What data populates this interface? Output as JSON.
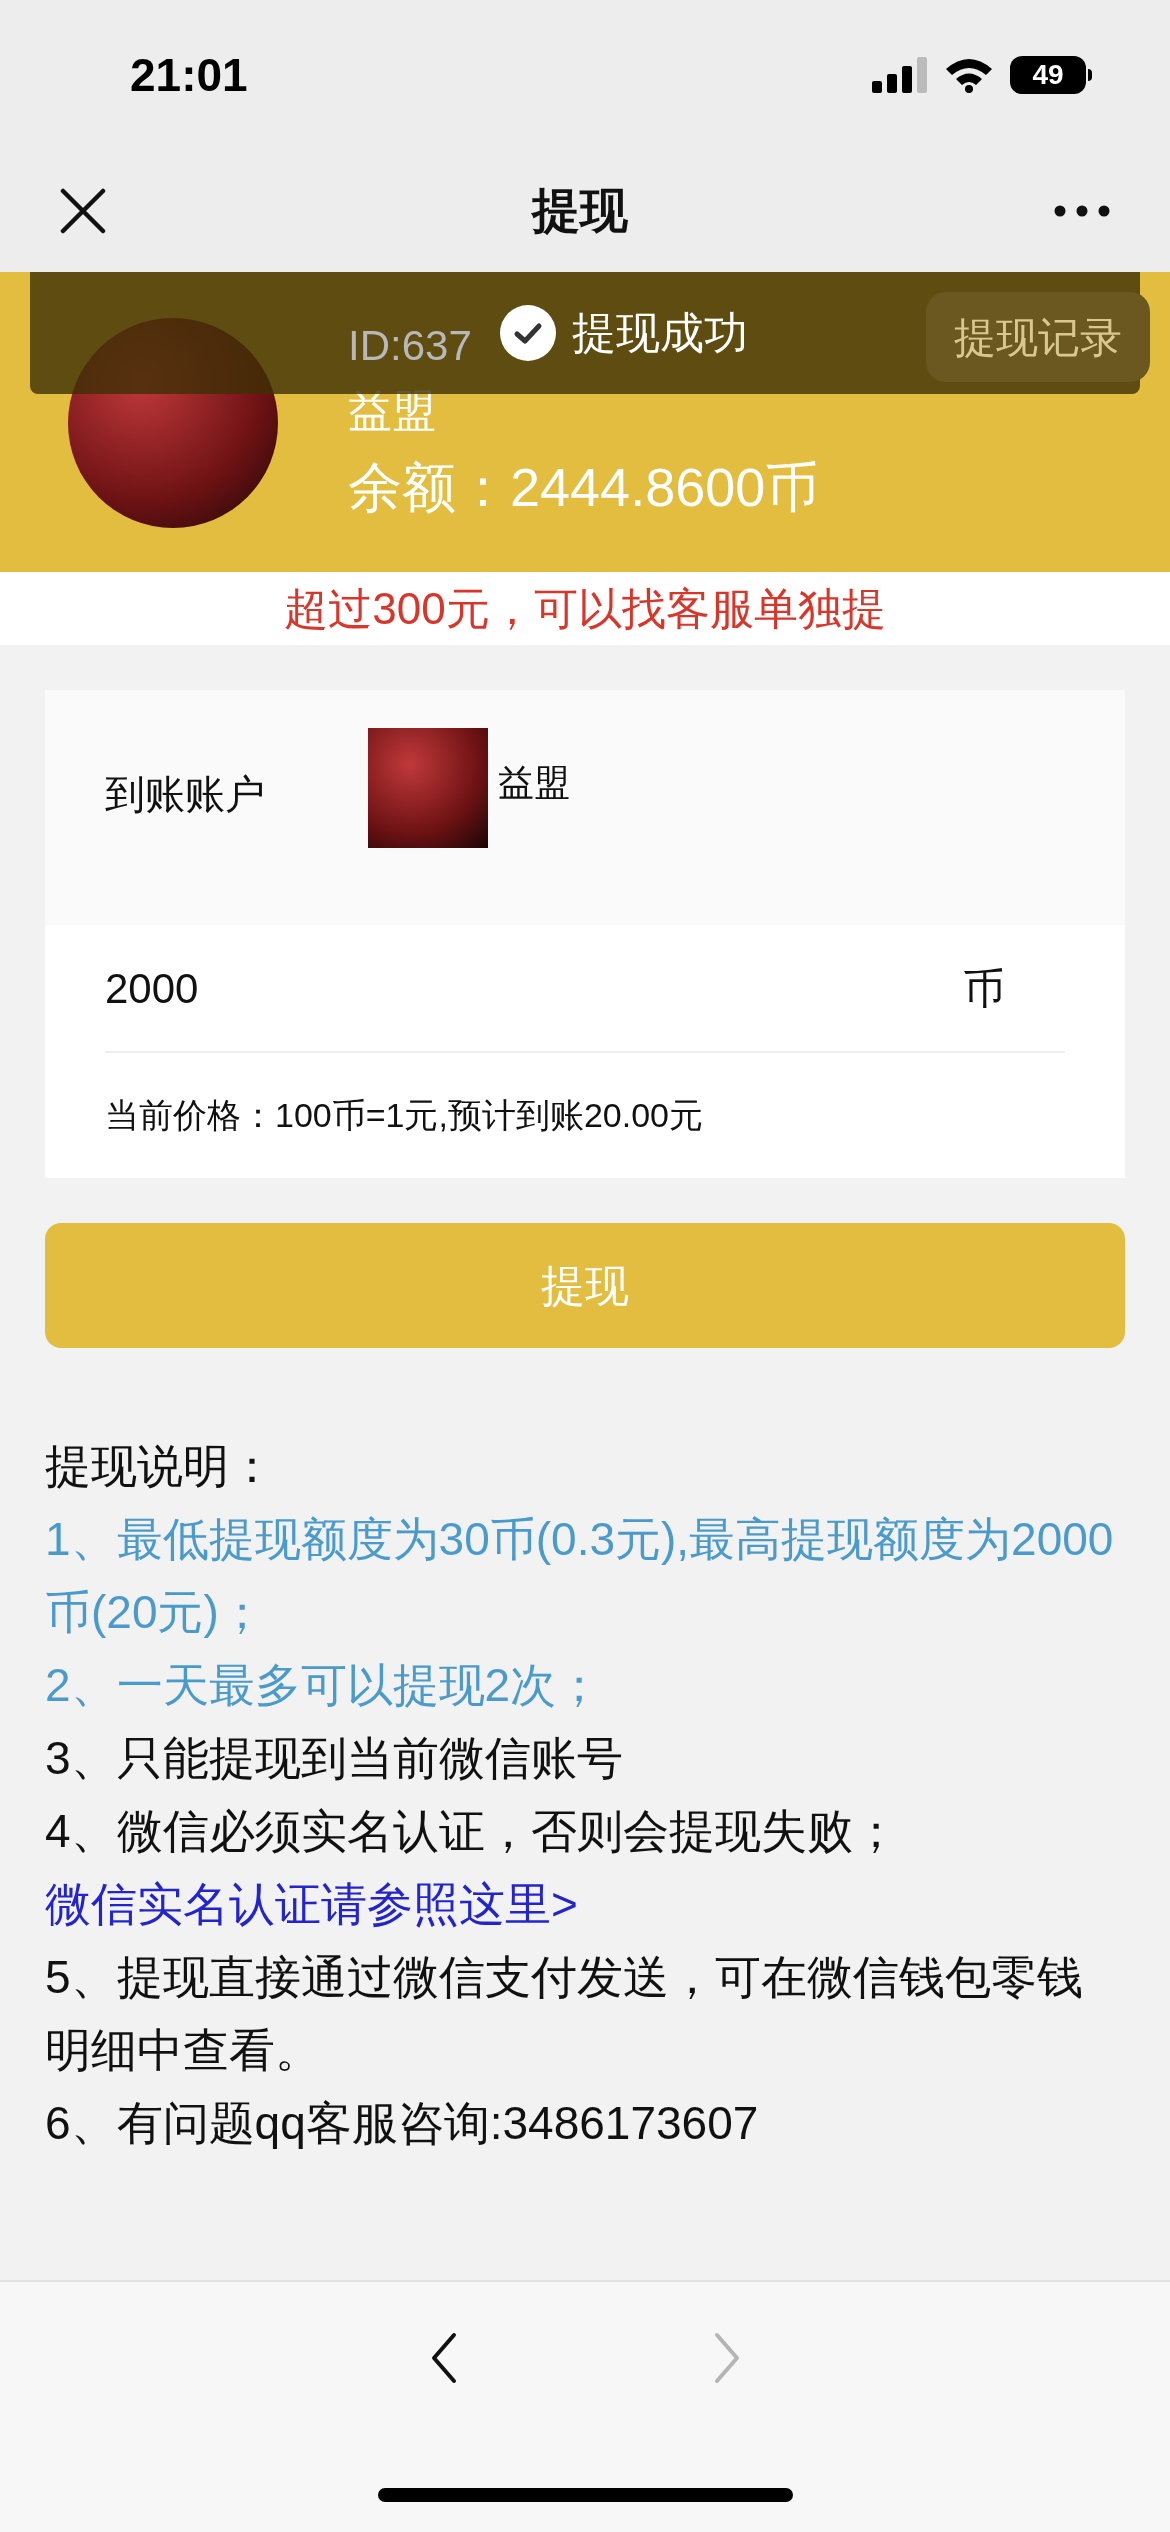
{
  "status_bar": {
    "time": "21:01",
    "battery": "49"
  },
  "nav": {
    "title": "提现"
  },
  "toast": {
    "text": "提现成功"
  },
  "profile": {
    "id": "ID:637",
    "name": "益盟",
    "balance": "余额：2444.8600币",
    "records_button": "提现记录"
  },
  "notice": "超过300元，可以找客服单独提",
  "account": {
    "label": "到账账户",
    "name": "益盟"
  },
  "amount": {
    "value": "2000",
    "unit": "币"
  },
  "price_note": "当前价格：100币=1元,预计到账20.00元",
  "submit_button": "提现",
  "instructions": {
    "title": "提现说明：",
    "items": [
      {
        "kind": "highlight",
        "text": "1、最低提现额度为30币(0.3元),最高提现额度为2000币(20元)；"
      },
      {
        "kind": "highlight",
        "text": "2、一天最多可以提现2次；"
      },
      {
        "kind": "plain",
        "text": "3、只能提现到当前微信账号"
      },
      {
        "kind": "plain",
        "text": "4、微信必须实名认证，否则会提现失败；",
        "link": "微信实名认证请参照这里>"
      },
      {
        "kind": "plain",
        "text": "5、提现直接通过微信支付发送，可在微信钱包零钱明细中查看。"
      },
      {
        "kind": "plain",
        "text": "6、有问题qq客服咨询:3486173607"
      }
    ]
  },
  "toolbar": {
    "buttons": [
      {
        "kind": "back",
        "disabled": false
      },
      {
        "kind": "forward",
        "disabled": true
      }
    ]
  }
}
